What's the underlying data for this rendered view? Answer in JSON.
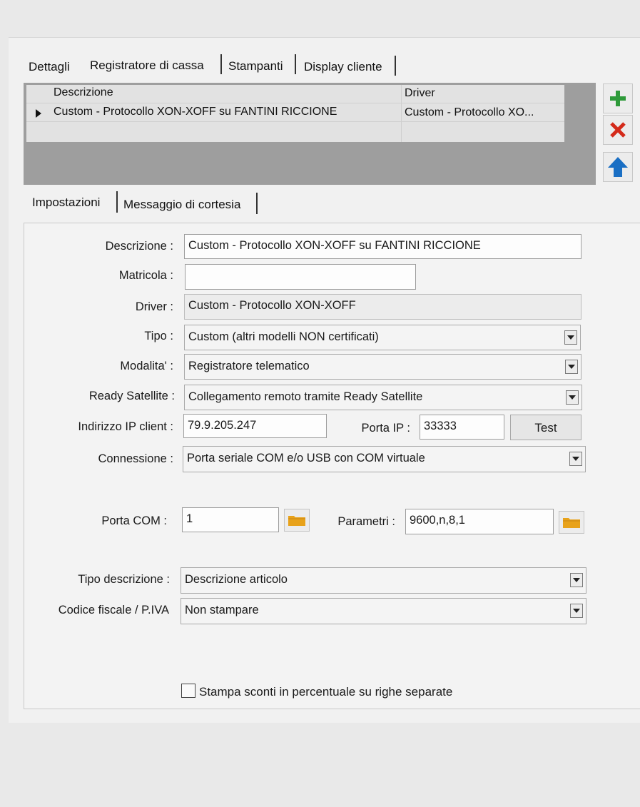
{
  "top_tabs": [
    "Dettagli",
    "Registratore di cassa",
    "Stampanti",
    "Display cliente"
  ],
  "grid": {
    "columns": [
      "Descrizione",
      "Driver"
    ],
    "rows": [
      {
        "descrizione": "Custom - Protocollo XON-XOFF su FANTINI RICCIONE",
        "driver": "Custom - Protocollo XO..."
      }
    ]
  },
  "side_buttons": {
    "add": "plus-icon",
    "delete": "x-icon",
    "move_up": "arrow-up-icon"
  },
  "sub_tabs": [
    "Impostazioni",
    "Messaggio di cortesia"
  ],
  "form": {
    "descrizione": {
      "label": "Descrizione :",
      "value": "Custom - Protocollo XON-XOFF su FANTINI RICCIONE"
    },
    "matricola": {
      "label": "Matricola :",
      "value": ""
    },
    "driver": {
      "label": "Driver :",
      "value": "Custom - Protocollo XON-XOFF"
    },
    "tipo": {
      "label": "Tipo :",
      "value": "Custom (altri modelli NON certificati)"
    },
    "modalita": {
      "label": "Modalita' :",
      "value": "Registratore telematico"
    },
    "ready_satellite": {
      "label": "Ready Satellite :",
      "value": "Collegamento remoto tramite Ready Satellite"
    },
    "indirizzo_ip": {
      "label": "Indirizzo IP client :",
      "value": "79.9.205.247"
    },
    "porta_ip": {
      "label": "Porta IP :",
      "value": "33333"
    },
    "test_button": "Test",
    "connessione": {
      "label": "Connessione :",
      "value": "Porta seriale COM e/o USB con COM virtuale"
    },
    "porta_com": {
      "label": "Porta COM :",
      "value": "1"
    },
    "parametri": {
      "label": "Parametri :",
      "value": "9600,n,8,1"
    },
    "tipo_descrizione": {
      "label": "Tipo descrizione :",
      "value": "Descrizione articolo"
    },
    "codice_fiscale": {
      "label": "Codice fiscale / P.IVA",
      "value": "Non stampare"
    },
    "stampa_sconti": {
      "label": "Stampa sconti in percentuale su righe separate",
      "checked": false
    }
  },
  "colors": {
    "add": "#2e9a3a",
    "delete": "#d42a1a",
    "move_up": "#1a6fc4",
    "folder": "#e8a21a"
  }
}
